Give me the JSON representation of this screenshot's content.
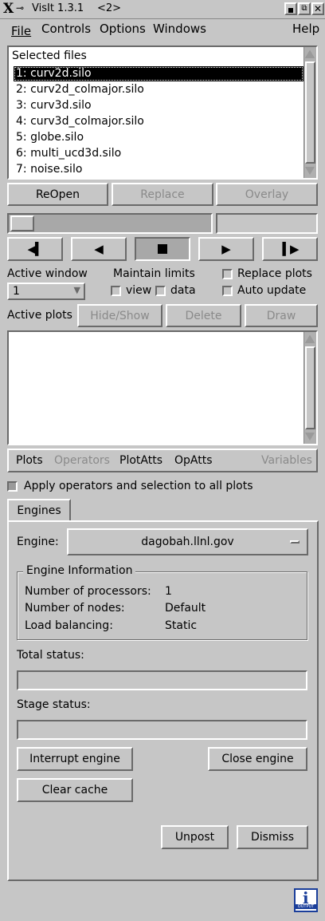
{
  "window": {
    "title": "VisIt 1.3.1",
    "title_suffix": "<2>"
  },
  "menu": {
    "file": "File",
    "controls": "Controls",
    "options": "Options",
    "windows": "Windows",
    "help": "Help"
  },
  "files": {
    "header": "Selected files",
    "items": [
      "1: curv2d.silo",
      "2: curv2d_colmajor.silo",
      "3: curv3d.silo",
      "4: curv3d_colmajor.silo",
      "5: globe.silo",
      "6: multi_ucd3d.silo",
      "7: noise.silo"
    ],
    "selected_index": 0
  },
  "file_buttons": {
    "reopen": "ReOpen",
    "replace": "Replace",
    "overlay": "Overlay"
  },
  "time": {
    "slider_fraction": 0.0,
    "state_value": ""
  },
  "playback_icons": [
    "prev-frame-icon",
    "reverse-play-icon",
    "stop-icon",
    "play-icon",
    "next-frame-icon"
  ],
  "active_window": {
    "label": "Active window",
    "value": "1"
  },
  "maintain_limits": {
    "label": "Maintain limits",
    "view": "view",
    "data": "data",
    "view_checked": false,
    "data_checked": false
  },
  "replace_plots": {
    "label": "Replace plots",
    "checked": false
  },
  "auto_update": {
    "label": "Auto update",
    "checked": false
  },
  "plots": {
    "label": "Active plots",
    "hide_show": "Hide/Show",
    "delete": "Delete",
    "draw": "Draw"
  },
  "plot_menu": {
    "plots": "Plots",
    "operators": "Operators",
    "plotatts": "PlotAtts",
    "opatts": "OpAtts",
    "variables": "Variables"
  },
  "apply_all": {
    "label": "Apply operators and selection to all plots",
    "checked": false
  },
  "engines": {
    "tab": "Engines",
    "engine_label": "Engine:",
    "engine_value": "dagobah.llnl.gov",
    "info_title": "Engine Information",
    "info": [
      {
        "key": "Number of processors:",
        "value": "1"
      },
      {
        "key": "Number of nodes:",
        "value": "Default"
      },
      {
        "key": "Load balancing:",
        "value": "Static"
      }
    ],
    "total_status_label": "Total status:",
    "stage_status_label": "Stage status:",
    "interrupt": "Interrupt engine",
    "close": "Close engine",
    "clear_cache": "Clear cache",
    "unpost": "Unpost",
    "dismiss": "Dismiss"
  },
  "output_icon": {
    "label": "OUTPUT",
    "glyph": "i"
  }
}
